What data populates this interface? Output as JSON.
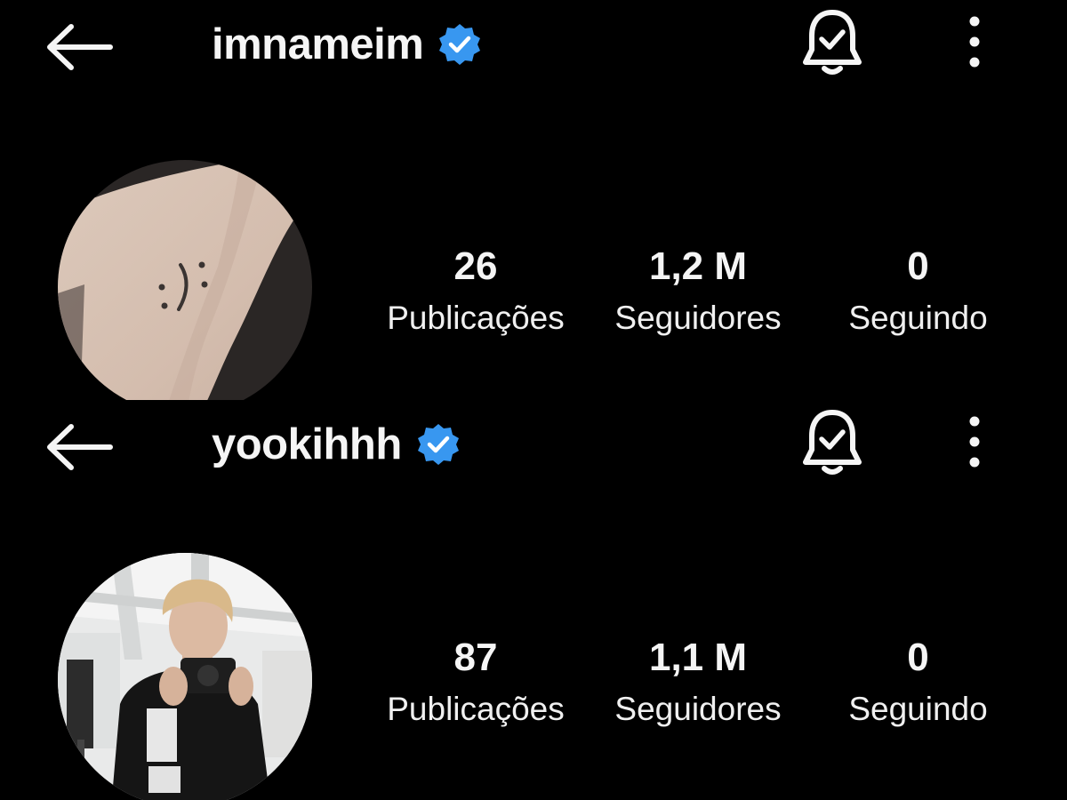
{
  "accent_color": "#3897f0",
  "profiles": [
    {
      "username": "imnameim",
      "verified": true,
      "icons": {
        "back": "arrow-left-icon",
        "notifications": "bell-check-icon",
        "more": "vertical-dots-icon",
        "verified": "verified-badge-icon"
      },
      "stats": {
        "posts": {
          "value": "26",
          "label": "Publicações"
        },
        "followers": {
          "value": "1,2 M",
          "label": "Seguidores"
        },
        "following": {
          "value": "0",
          "label": "Seguindo"
        }
      }
    },
    {
      "username": "yookihhh",
      "verified": true,
      "icons": {
        "back": "arrow-left-icon",
        "notifications": "bell-check-icon",
        "more": "vertical-dots-icon",
        "verified": "verified-badge-icon"
      },
      "stats": {
        "posts": {
          "value": "87",
          "label": "Publicações"
        },
        "followers": {
          "value": "1,1 M",
          "label": "Seguidores"
        },
        "following": {
          "value": "0",
          "label": "Seguindo"
        }
      }
    }
  ]
}
